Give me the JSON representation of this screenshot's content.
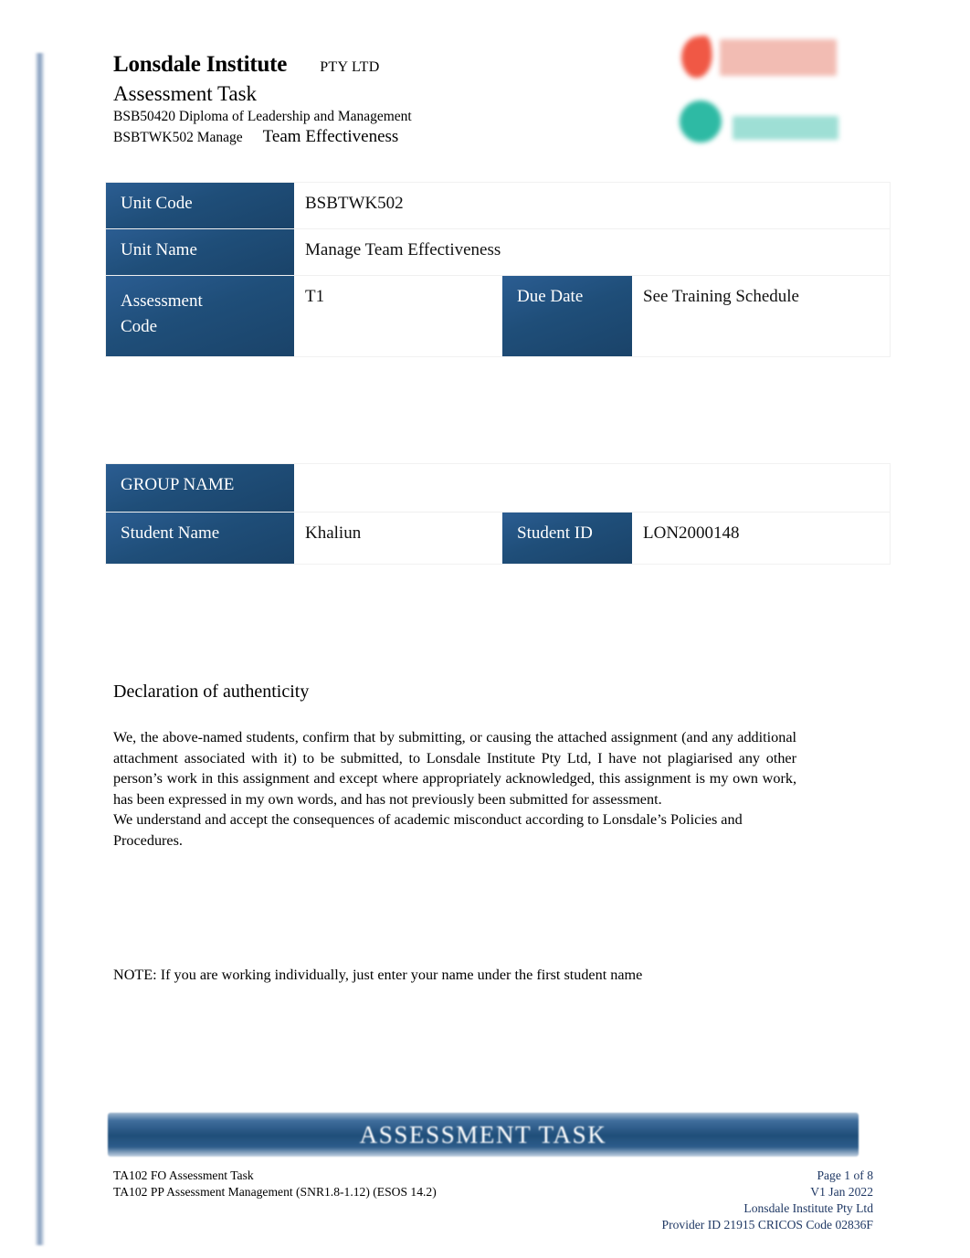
{
  "header": {
    "org_name": "Lonsdale Institute",
    "org_suffix": "PTY LTD",
    "doc_title": "Assessment Task",
    "qualification": "BSB50420 Diploma of Leadership and Management",
    "unit_line_code": "BSBTWK502 Manage",
    "unit_line_name": "Team Effectiveness"
  },
  "logos": {
    "primary_logo_name": "red-flame-logo",
    "secondary_logo_name": "green-circle-logo",
    "primary_color": "#ef4a35",
    "secondary_color": "#17b39a"
  },
  "unit_table": {
    "rows": [
      {
        "label": "Unit Code",
        "value": "BSBTWK502"
      },
      {
        "label": "Unit Name",
        "value": "Manage Team Effectiveness"
      }
    ],
    "split_row": {
      "label": "Assessment Code",
      "label_line1": "Assessment",
      "label_line2": "Code",
      "value": "T1",
      "second_label": "Due Date",
      "second_value": "See Training Schedule"
    }
  },
  "student_table": {
    "group_row": {
      "label": "GROUP NAME",
      "value": ""
    },
    "split_row": {
      "label": "Student Name",
      "value": "Khaliun",
      "second_label": "Student ID",
      "second_value": "LON2000148"
    }
  },
  "declaration": {
    "heading": "Declaration of authenticity",
    "paragraph_1": "We, the above-named students, confirm that by submitting, or causing the attached assignment (and any additional attachment associated with it) to be submitted, to Lonsdale Institute Pty Ltd, I have not plagiarised any other person’s work in this assignment and except where appropriately acknowledged, this assignment is my own work, has been expressed in my own words, and has not previously been submitted for assessment.",
    "paragraph_2": "We understand and accept the consequences of academic misconduct according to Lonsdale’s Policies and Procedures.",
    "note": "NOTE:  If you are working individually, just enter your name under the first student name"
  },
  "banner": {
    "text": "ASSESSMENT TASK",
    "color": "#1f4e79"
  },
  "footer": {
    "left_line_1": "TA102 FO Assessment Task",
    "left_line_2": "TA102 PP Assessment Management (SNR1.8-1.12) (ESOS 14.2)",
    "right_line_1": "Page 1 of 8",
    "right_line_2": "V1 Jan 2022",
    "right_line_3": "Lonsdale Institute Pty Ltd",
    "right_line_4": "Provider ID 21915 CRICOS Code 02836F",
    "right_color": "#1f3864"
  }
}
